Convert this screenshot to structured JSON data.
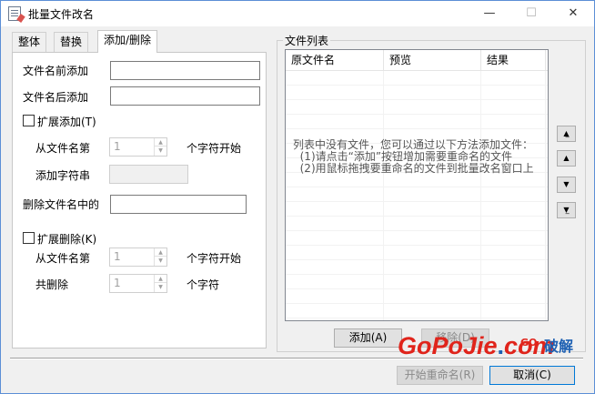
{
  "window": {
    "title": "批量文件改名",
    "minimize": "—",
    "maximize": "☐",
    "close": "✕"
  },
  "tabs": [
    "整体",
    "替换",
    "添加/删除"
  ],
  "active_tab": "添加/删除",
  "add_delete": {
    "prefix_label": "文件名前添加",
    "prefix_value": "",
    "suffix_label": "文件名后添加",
    "suffix_value": "",
    "extend_add_label": "扩展添加(T)",
    "extend_add_checked": false,
    "from_pos_label": "从文件名第",
    "from_pos_value": "1",
    "char_start_label": "个字符开始",
    "add_string_label": "添加字符串",
    "delete_in_name_label": "删除文件名中的",
    "delete_in_name_value": "",
    "extend_delete_label": "扩展删除(K)",
    "extend_delete_checked": false,
    "del_from_label": "从文件名第",
    "del_from_value": "1",
    "del_char_start_label": "个字符开始",
    "del_count_label": "共删除",
    "del_count_value": "1",
    "del_count_unit": "个字符"
  },
  "file_list": {
    "group_title": "文件列表",
    "columns": [
      "原文件名",
      "预览",
      "结果"
    ],
    "empty_message_lines": [
      "列表中没有文件，您可以通过以下方法添加文件：",
      "  (1)请点击“添加”按钮增加需要重命名的文件",
      "  (2)用鼠标拖拽要重命名的文件到批量改名窗口上"
    ],
    "add_button": "添加(A)",
    "remove_button": "移除(D)"
  },
  "side_buttons": {
    "top": "▲̲",
    "up": "▲",
    "down": "▼",
    "bottom": "▼̲"
  },
  "footer": {
    "start_button": "开始重命名(R)",
    "cancel_button": "取消(C)"
  },
  "watermark": {
    "main": "GoPoJie",
    "dot": ".",
    "tld": "com",
    "sub_go": "GO",
    "sub_text": "破解"
  }
}
